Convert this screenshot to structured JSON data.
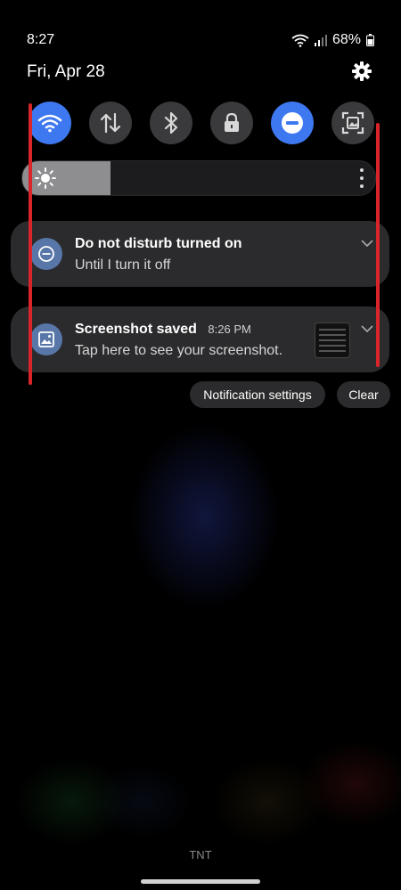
{
  "status_bar": {
    "time": "8:27",
    "battery": "68%"
  },
  "header": {
    "date": "Fri, Apr 28"
  },
  "quick_settings": [
    {
      "name": "wifi",
      "icon": "wifi-icon",
      "on": true
    },
    {
      "name": "mobile-data",
      "icon": "mobile-data-icon",
      "on": false
    },
    {
      "name": "bluetooth",
      "icon": "bluetooth-icon",
      "on": false
    },
    {
      "name": "screen-lock",
      "icon": "lock-icon",
      "on": false
    },
    {
      "name": "do-not-disturb",
      "icon": "do-not-disturb-icon",
      "on": true
    },
    {
      "name": "screenshot",
      "icon": "screenshot-icon",
      "on": false
    }
  ],
  "brightness": {
    "level": 0.25
  },
  "notifications": [
    {
      "icon": "do-not-disturb-icon",
      "title": "Do not disturb turned on",
      "text": "Until I turn it off"
    },
    {
      "icon": "image-icon",
      "title": "Screenshot saved",
      "time": "8:26 PM",
      "text": "Tap here to see your screenshot."
    }
  ],
  "actions": {
    "notification_settings": "Notification settings",
    "clear": "Clear"
  },
  "footer": {
    "carrier": "TNT"
  },
  "colors": {
    "accent": "#3e78f0",
    "annotation_red": "#d9252a",
    "notification_icon": "#5877a8"
  }
}
